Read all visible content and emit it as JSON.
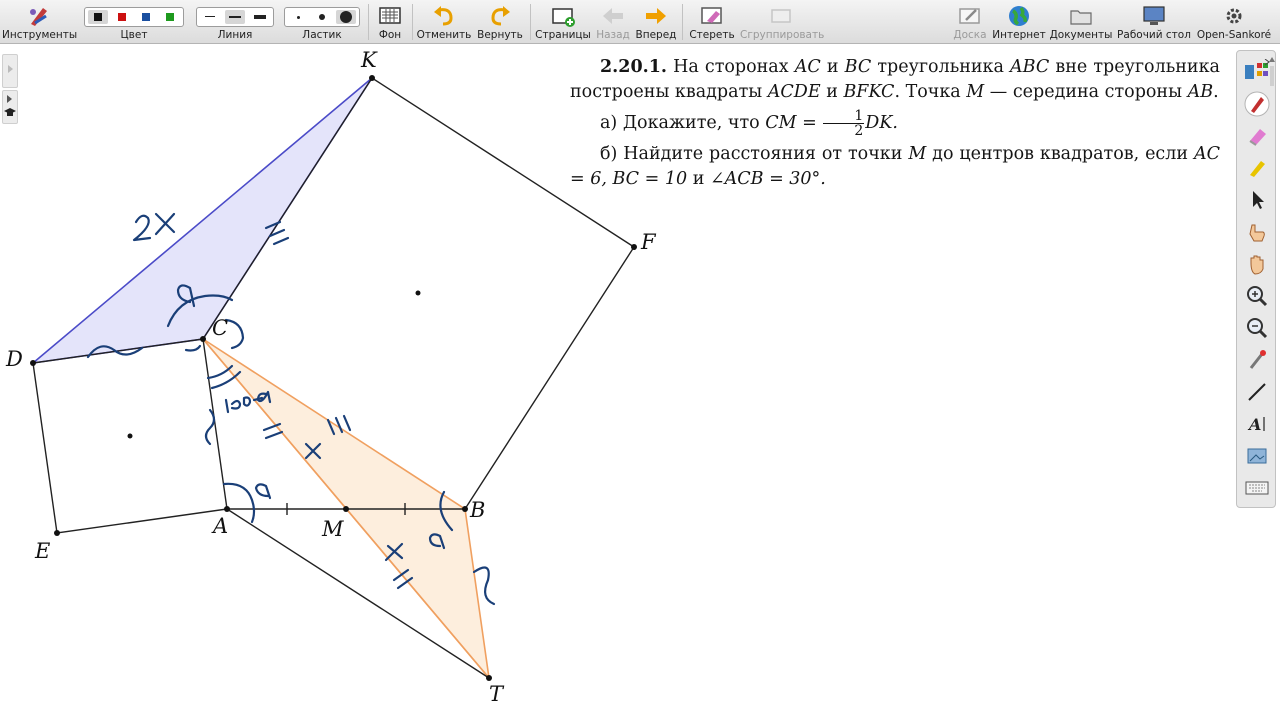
{
  "toolbar": {
    "tools_label": "Инструменты",
    "color_label": "Цвет",
    "line_label": "Линия",
    "eraser_label": "Ластик",
    "background_label": "Фон",
    "undo_label": "Отменить",
    "redo_label": "Вернуть",
    "pages_label": "Страницы",
    "back_label": "Назад",
    "forward_label": "Вперед",
    "erase_label": "Стереть",
    "group_label": "Сгруппировать",
    "board_label": "Доска",
    "internet_label": "Интернет",
    "documents_label": "Документы",
    "desktop_label": "Рабочий стол",
    "app_label": "Open-Sankoré",
    "colors": [
      "#111111",
      "#cc1111",
      "#1a4fa0",
      "#1e9a1e"
    ]
  },
  "problem": {
    "number": "2.20.1.",
    "statement_1": "На сторонах",
    "ac": "AC",
    "and_1": "и",
    "bc": "BC",
    "statement_2": "треугольника",
    "abc": "ABC",
    "statement_3": "вне треугольника построены квадраты",
    "acde": "ACDE",
    "and_2": "и",
    "bfkc": "BFKC",
    "statement_4": ". Точка",
    "m": "M",
    "statement_5": "— середина стороны",
    "ab": "AB",
    "dot": ".",
    "part_a_prefix": "а) Докажите, что",
    "part_a_lhs": "CM =",
    "frac_num": "1",
    "frac_den": "2",
    "part_a_rhs": "DK.",
    "part_b_prefix": "б) Найдите расстояния от точки",
    "part_b_m": "M",
    "part_b_middle": "до центров квадратов, если",
    "part_b_ac": "AC = 6, BC = 10",
    "part_b_and": "и",
    "part_b_angle": "∠ACB = 30°."
  },
  "figure": {
    "points": {
      "K": "K",
      "F": "F",
      "C": "C",
      "D": "D",
      "E": "E",
      "A": "A",
      "M": "M",
      "B": "B",
      "T": "T"
    },
    "annotations": {
      "two_x": "2x",
      "alpha": "α",
      "supplement": "180-α",
      "x": "x"
    },
    "colors": {
      "blue_triangle_fill": "#e4e4fa",
      "blue_triangle_stroke": "#4b4bc8",
      "orange_triangle_fill": "#fdeedd",
      "orange_triangle_stroke": "#f0a060",
      "ink_blue": "#1a3f78"
    }
  }
}
